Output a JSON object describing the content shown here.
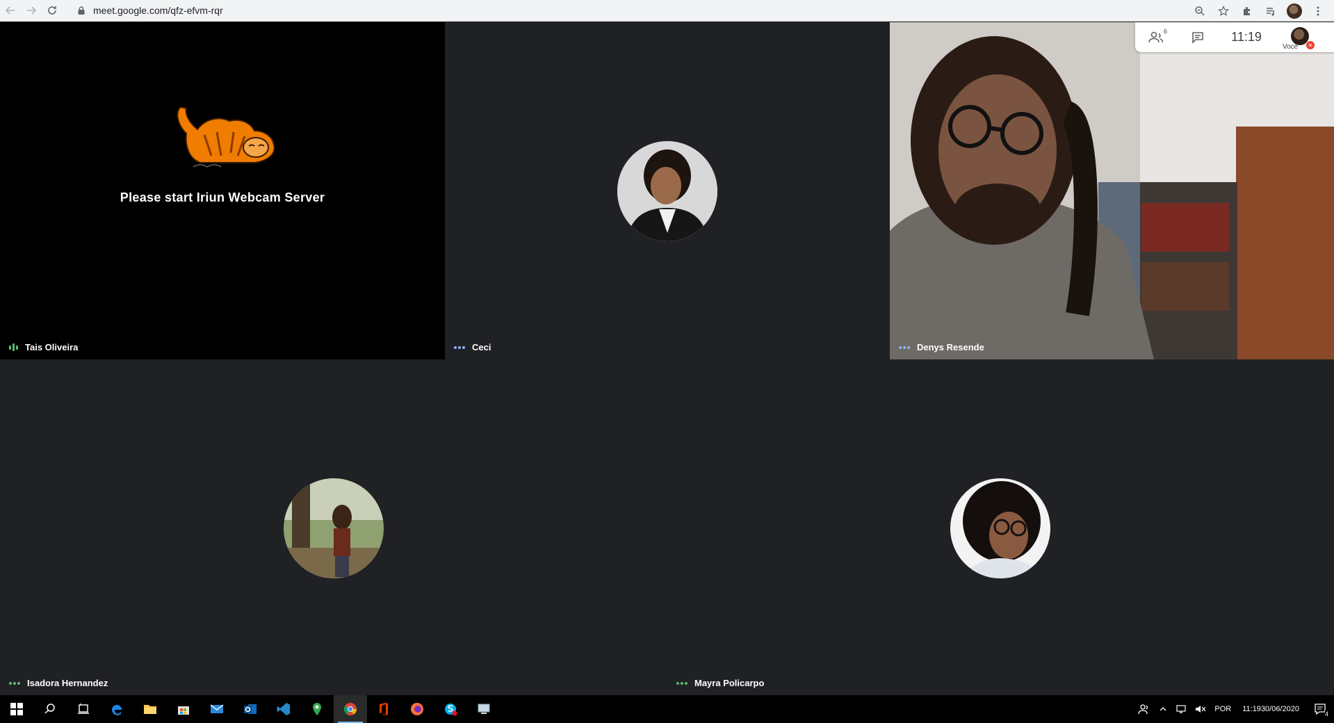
{
  "browser": {
    "url": "meet.google.com/qfz-efvm-rqr"
  },
  "meet": {
    "participants_count": "6",
    "time": "11:19",
    "you_label": "Você",
    "tiles": [
      {
        "name": "Tais Oliveira",
        "message": "Please start Iriun Webcam Server",
        "speaking": true
      },
      {
        "name": "Ceci"
      },
      {
        "name": "Denys Resende"
      },
      {
        "name": "Isadora Hernandez"
      },
      {
        "name": "Mayra Policarpo"
      }
    ]
  },
  "taskbar": {
    "language": "POR",
    "time": "11:19",
    "date": "30/06/2020",
    "notifications": "4"
  },
  "colors": {
    "meet_bg": "#202124",
    "accent_dots": "#8ab4f8",
    "speaking": "#5bb974"
  }
}
